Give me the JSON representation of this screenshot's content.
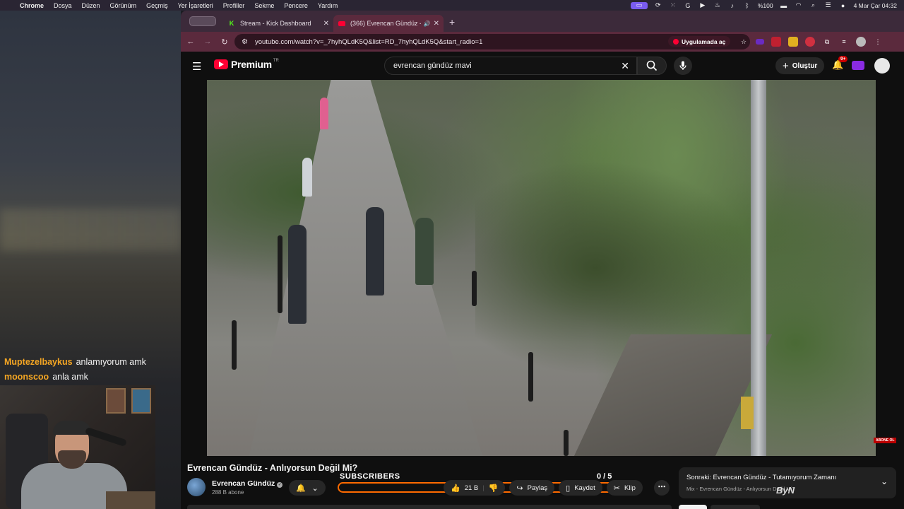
{
  "menubar": {
    "app": "Chrome",
    "items": [
      "Dosya",
      "Düzen",
      "Görünüm",
      "Geçmiş",
      "Yer İşaretleri",
      "Profiller",
      "Sekme",
      "Pencere",
      "Yardım"
    ],
    "battery": "%100",
    "clock": "4 Mar Çar  04:32"
  },
  "chat": [
    {
      "user": "Muptezelbaykus",
      "message": "anlamıyorum amk"
    },
    {
      "user": "moonscoo",
      "message": "anla amk"
    }
  ],
  "browser": {
    "tabs": [
      {
        "title": "Stream - Kick Dashboard",
        "favicon": "K",
        "active": false
      },
      {
        "title": "(366) Evrencan Gündüz -",
        "favicon": "yt",
        "active": true
      }
    ],
    "url": "youtube.com/watch?v=_7hyhQLdK5Q&list=RD_7hyhQLdK5Q&start_radio=1",
    "open_in_app": "Uygulamada aç"
  },
  "youtube": {
    "logo_text": "Premium",
    "region": "TR",
    "search_value": "evrencan gündüz mavi",
    "create_label": "Oluştur",
    "notifications_badge": "9+",
    "abone_badge": "ABONE OL",
    "video": {
      "title": "Evrencan Gündüz - Anlıyorsun Değil Mi?",
      "channel": "Evrencan Gündüz",
      "subscribers": "288 B abone",
      "likes": "21 B",
      "share_label": "Paylaş",
      "save_label": "Kaydet",
      "clip_label": "Klip"
    },
    "overlay": {
      "label": "SUBSCRIBERS",
      "count": "0  / 5",
      "progress_fraction": 0
    },
    "up_next": {
      "label": "Sonraki: Evrencan Gündüz - Tutamıyorum Zamanı",
      "sub": "Mix - Evrencan Gündüz - Anlıyorsun Değil Mi?"
    },
    "watermark": "ByN"
  }
}
